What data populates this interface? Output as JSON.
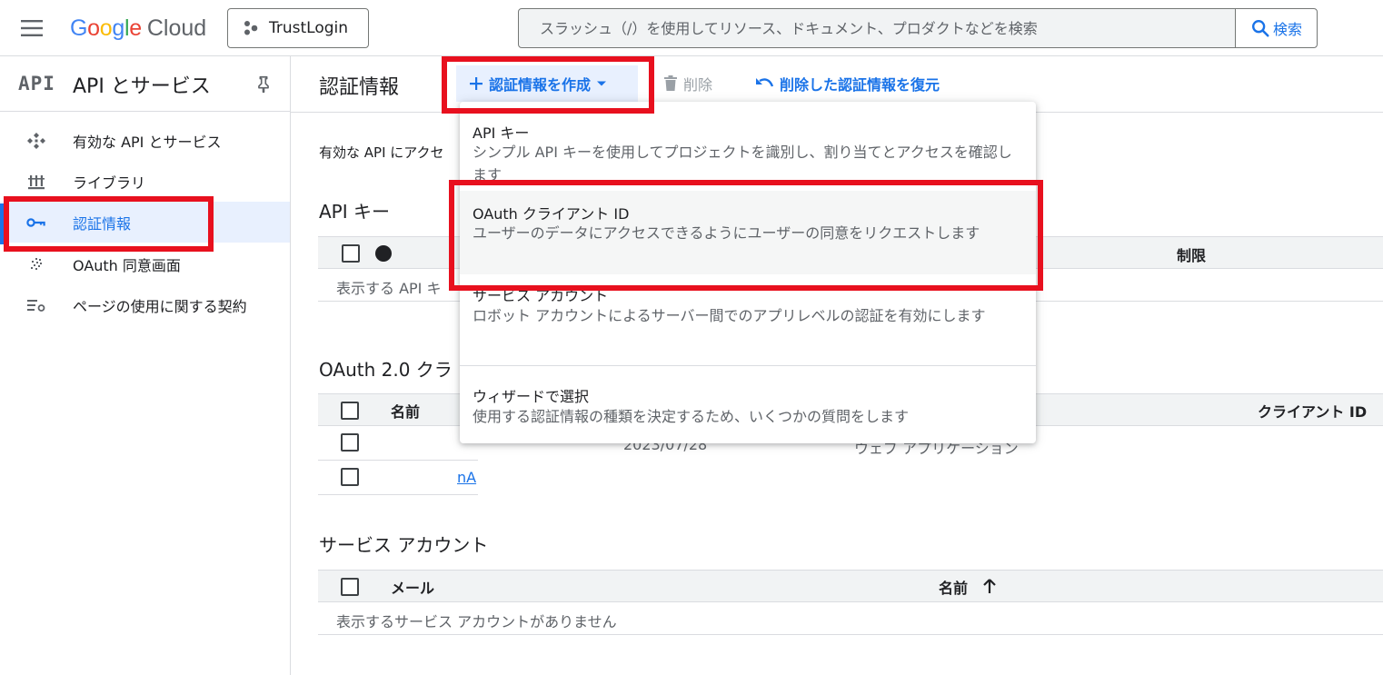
{
  "topbar": {
    "brand_google": "Google",
    "brand_cloud": "Cloud",
    "project_name": "TrustLogin",
    "search_placeholder": "スラッシュ（/）を使用してリソース、ドキュメント、プロダクトなどを検索",
    "search_button": "検索"
  },
  "sidebar": {
    "api_glyph": "API",
    "title": "API とサービス",
    "items": [
      {
        "label": "有効な API とサービス",
        "icon": "api-hub-icon",
        "active": false
      },
      {
        "label": "ライブラリ",
        "icon": "library-icon",
        "active": false
      },
      {
        "label": "認証情報",
        "icon": "key-icon",
        "active": true
      },
      {
        "label": "OAuth 同意画面",
        "icon": "consent-icon",
        "active": false
      },
      {
        "label": "ページの使用に関する契約",
        "icon": "settings-list-icon",
        "active": false
      }
    ]
  },
  "main": {
    "title": "認証情報",
    "create_button": "認証情報を作成",
    "delete_button": "削除",
    "restore_button": "削除した認証情報を復元",
    "intro_text": "有効な API にアクセ",
    "api_keys": {
      "title": "API キー",
      "col_restriction": "制限",
      "empty_text": "表示する API キ"
    },
    "oauth": {
      "title": "OAuth 2.0 クラ",
      "col_name": "名前",
      "col_client_id": "クライアント ID",
      "row_partial_date": "2023/07/28",
      "row_partial_type": "ウェブ アプリケーション",
      "row_link_fragment": "nA"
    },
    "service_accounts": {
      "title": "サービス アカウント",
      "col_email": "メール",
      "col_name": "名前",
      "empty_text": "表示するサービス アカウントがありません"
    }
  },
  "dropdown": {
    "items": [
      {
        "title": "API キー",
        "desc": "シンプル API キーを使用してプロジェクトを識別し、割り当てとアクセスを確認します"
      },
      {
        "title": "OAuth クライアント ID",
        "desc": "ユーザーのデータにアクセスできるようにユーザーの同意をリクエストします"
      },
      {
        "title": "サービス アカウント",
        "desc": "ロボット アカウントによるサーバー間でのアプリレベルの認証を有効にします"
      },
      {
        "title": "ウィザードで選択",
        "desc": "使用する認証情報の種類を決定するため、いくつかの質問をします"
      }
    ]
  },
  "colors": {
    "accent": "#1a73e8",
    "highlight_red": "#e8101e",
    "active_bg": "#e8f0fe"
  }
}
